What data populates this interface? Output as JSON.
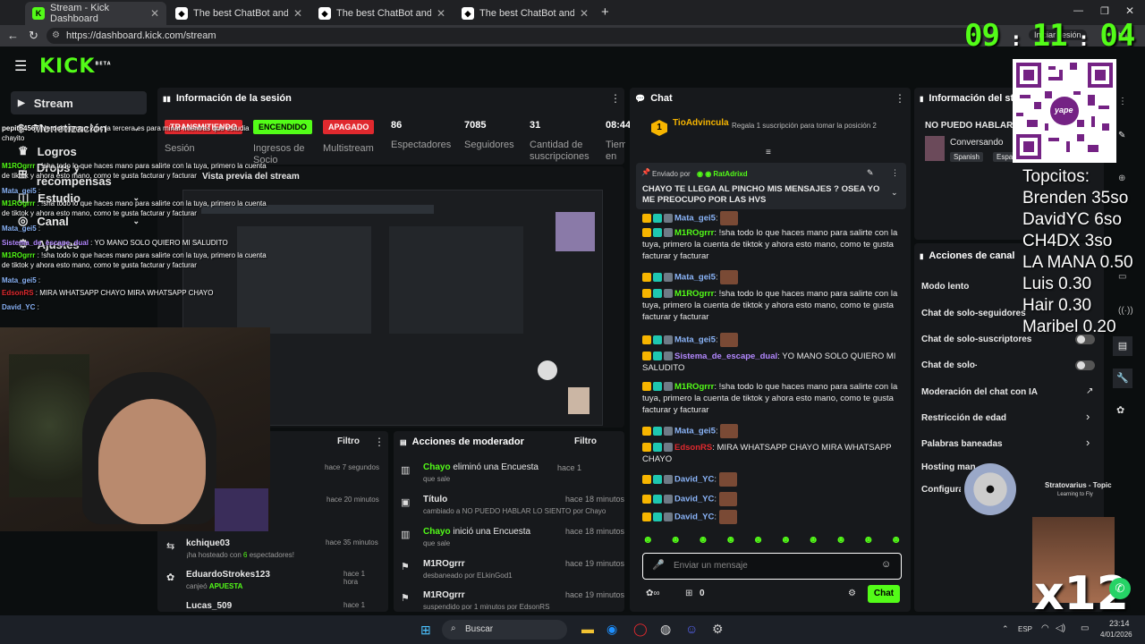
{
  "browser": {
    "tabs": [
      {
        "title": "Stream - Kick Dashboard",
        "active": true
      },
      {
        "title": "The best ChatBot and Widgets fo"
      },
      {
        "title": "The best ChatBot and Widgets fo"
      },
      {
        "title": "The best ChatBot and Widgets fo"
      }
    ],
    "new_tab": "+",
    "url": "https://dashboard.kick.com/stream",
    "login_label": "Iniciar sesión",
    "chat_label": "hat"
  },
  "clock": {
    "h": "09",
    "m": "11",
    "s": "04"
  },
  "kick": {
    "logo": "KICK",
    "beta": "BETA",
    "sidebar": [
      {
        "label": "Stream",
        "icon": "video-icon"
      },
      {
        "label": "Monetización"
      },
      {
        "label": "Logros"
      },
      {
        "label": "Drops y recompensas"
      },
      {
        "label": "Estudio"
      },
      {
        "label": "Canal"
      },
      {
        "label": "Ajustes"
      }
    ]
  },
  "session": {
    "title": "Información de la sesión",
    "badges": [
      {
        "text": "TRANSMITIENDO",
        "color": "#e0292e"
      },
      {
        "text": "ENCENDIDO",
        "color": "#53fc18"
      },
      {
        "text": "APAGADO",
        "color": "#e0292e"
      }
    ],
    "stats": [
      {
        "value": "86",
        "label": "Espectadores"
      },
      {
        "value": "7085",
        "label": "Seguidores"
      },
      {
        "value": "31",
        "label": "Cantidad de suscripciones"
      },
      {
        "value": "08:44",
        "label": "Tiempo en vivo"
      }
    ],
    "labels": [
      "Sesión",
      "Ingresos de Socio",
      "Multistream"
    ],
    "preview_label": "Vista previa del stream"
  },
  "activity": {
    "filter": "Filtro",
    "items": [
      {
        "time": "hace 7 segundos"
      },
      {
        "time": "hace 20 minutos"
      },
      {
        "user": "kchique03",
        "text": "¡ha hosteado con ",
        "count": "6",
        "text2": " espectadores!",
        "time": "hace 35 minutos"
      },
      {
        "user": "EduardoStrokes123",
        "text": "canjeó ",
        "reward": "APUESTA",
        "time": "hace 1 hora"
      },
      {
        "user": "Lucas_509",
        "time": "hace 1 hora"
      }
    ]
  },
  "mod_actions": {
    "title": "Acciones de moderador",
    "filter": "Filtro",
    "items": [
      {
        "actor": "Chayo",
        "action": " eliminó una Encuesta",
        "sub": "que sale",
        "time": "hace 1"
      },
      {
        "actor": "Título",
        "action": "",
        "sub": "cambiado a NO PUEDO HABLAR LO SIENTO por Chayo",
        "time": "hace 18 minutos"
      },
      {
        "actor": "Chayo",
        "action": " inició una Encuesta",
        "sub": "que sale",
        "time": "hace 18 minutos"
      },
      {
        "actor": "M1ROgrrr",
        "action": "",
        "sub": "desbaneado por ELkinGod1",
        "time": "hace 19 minutos"
      },
      {
        "actor": "M1ROgrrr",
        "action": "",
        "sub": "suspendido por 1 minutos por EdsonRS",
        "time": "hace 19 minutos"
      }
    ]
  },
  "chat": {
    "title": "Chat",
    "top_gifter": {
      "name": "TioAdvincula",
      "rank": "1",
      "cta": "Regala 1 suscripción para tomar la posición 2"
    },
    "pinned": {
      "by_label": "Enviado por",
      "by": "RatAdrixd",
      "text": "CHAYO TE LLEGA AL PINCHO MIS MENSAJES ? OSEA YO ME PREOCUPO POR LAS HVS"
    },
    "messages": [
      {
        "user": "Mata_gei5",
        "text": "",
        "color": "#8ab4f8"
      },
      {
        "user": "M1ROgrrr",
        "text": "!sha todo lo que haces mano para salirte con la tuya, primero la cuenta de tiktok y ahora esto mano, como te gusta facturar y facturar",
        "color": "#53fc18"
      },
      {
        "user": "Mata_gei5",
        "text": "",
        "color": "#8ab4f8"
      },
      {
        "user": "M1ROgrrr",
        "text": "!sha todo lo que haces mano para salirte con la tuya, primero la cuenta de tiktok y ahora esto mano, como te gusta facturar y facturar",
        "color": "#53fc18"
      },
      {
        "user": "Mata_gei5",
        "text": "",
        "color": "#8ab4f8"
      },
      {
        "user": "Sistema_de_escape_dual",
        "text": "YO MANO SOLO QUIERO MI SALUDITO",
        "color": "#b388ff"
      },
      {
        "user": "M1ROgrrr",
        "text": "!sha todo lo que haces mano para salirte con la tuya, primero la cuenta de tiktok y ahora esto mano, como te gusta facturar y facturar",
        "color": "#53fc18"
      },
      {
        "user": "Mata_gei5",
        "text": "",
        "color": "#8ab4f8"
      },
      {
        "user": "EdsonRS",
        "text": "MIRA WHATSAPP CHAYO MIRA WHATSAPP CHAYO",
        "color": "#e0292e"
      },
      {
        "user": "David_YC",
        "text": "",
        "color": "#8ab4f8"
      },
      {
        "user": "David_YC",
        "text": "",
        "color": "#8ab4f8"
      },
      {
        "user": "David_YC",
        "text": "",
        "color": "#8ab4f8"
      }
    ],
    "placeholder": "Enviar un mensaje",
    "points": "0",
    "send": "Chat"
  },
  "stream_info": {
    "title": "Información del stream",
    "stream_title": "NO PUEDO HABLAR LO SIENTO",
    "category": "Conversando",
    "tags": [
      "Spanish",
      "Espa"
    ]
  },
  "channel_actions": {
    "title": "Acciones de canal",
    "items": [
      {
        "label": "Modo lento"
      },
      {
        "label": "Chat de solo-seguidores"
      },
      {
        "label": "Chat de solo-suscriptores"
      },
      {
        "label": "Chat de solo-emotes"
      },
      {
        "label": "Moderación del chat con IA"
      },
      {
        "label": "Restricción de edad"
      },
      {
        "label": "Palabras baneadas"
      },
      {
        "label": "Hosting manual"
      },
      {
        "label": "Configuración"
      }
    ]
  },
  "overlay": {
    "topcitos_title": "Topcitos:",
    "topcitos": [
      "Brenden 35so",
      "DavidYC 6so",
      "CH4DX 3so",
      "LA MANA 0.50",
      "Luis 0.30",
      "Hair 0.30",
      "Maribel 0.20"
    ],
    "qr_label": "yape",
    "music_title": "Stratovarius - Topic",
    "music_sub": "Learning to Fly",
    "multiplier": "x12",
    "chat": [
      {
        "user": "pepito4567",
        "text": "Nerdcito tengo 2 pc la tercera es para minar mientras que estudia chayito",
        "color": "#ffffff"
      },
      {
        "user": "M1ROgrrr",
        "text": ": !sha todo lo que haces mano para salirte con la tuya, primero la cuenta de tiktok y ahora esto mano, como te gusta facturar y facturar",
        "color": "#53fc18"
      },
      {
        "user": "Mata_gei5",
        "text": ":",
        "color": "#8ab4f8"
      },
      {
        "user": "M1ROgrrr",
        "text": ": !sha todo lo que haces mano para salirte con la tuya, primero la cuenta de tiktok y ahora esto mano, como te gusta facturar y facturar",
        "color": "#53fc18"
      },
      {
        "user": "Mata_gei5",
        "text": ":",
        "color": "#8ab4f8"
      },
      {
        "user": "Sistema_de_escape_dual",
        "text": ": YO MANO SOLO QUIERO MI SALUDITO",
        "color": "#b388ff"
      },
      {
        "user": "M1ROgrrr",
        "text": ": !sha todo lo que haces mano para salirte con la tuya, primero la cuenta de tiktok y ahora esto mano, como te gusta facturar y facturar",
        "color": "#53fc18"
      },
      {
        "user": "Mata_gei5",
        "text": ":",
        "color": "#8ab4f8"
      },
      {
        "user": "EdsonRS",
        "text": ": MIRA WHATSAPP CHAYO MIRA WHATSAPP CHAYO",
        "color": "#e0292e"
      },
      {
        "user": "David_YC",
        "text": ":",
        "color": "#8ab4f8"
      }
    ]
  },
  "taskbar": {
    "search": "Buscar",
    "lang": "ESP",
    "time": "23:14",
    "date": "4/01/2026"
  }
}
